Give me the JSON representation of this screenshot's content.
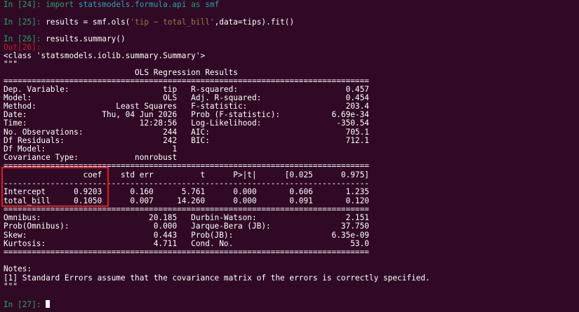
{
  "terminal": {
    "cells": [
      {
        "prompt": "In [24]: ",
        "import_kw": "import",
        "module": "statsmodels.formula.api",
        "as_kw": "as",
        "alias": "smf"
      },
      {
        "prompt": "In [25]: ",
        "code_pre": "results = smf.ols(",
        "code_str": "'tip ~ total_bill'",
        "code_post": ",data=tips).fit()"
      },
      {
        "prompt": "In [26]: ",
        "code": "results.summary()"
      },
      {
        "prompt": "In [27]: "
      }
    ],
    "out_prompt": "Out[26]:",
    "output_lines": [
      "<class 'statsmodels.iolib.summary.Summary'>",
      "\"\"\"",
      "                            OLS Regression Results",
      "==============================================================================",
      "Dep. Variable:                    tip   R-squared:                       0.457",
      "Model:                            OLS   Adj. R-squared:                  0.454",
      "Method:                 Least Squares   F-statistic:                     203.4",
      "Date:                Thu, 04 Jun 2026   Prob (F-statistic):           6.69e-34",
      "Time:                        12:28:56   Log-Likelihood:                -350.54",
      "No. Observations:                 244   AIC:                             705.1",
      "Df Residuals:                     242   BIC:                             712.1",
      "Df Model:                           1",
      "Covariance Type:            nonrobust",
      "==============================================================================",
      "                 coef    std err          t      P>|t|      [0.025      0.975]",
      "------------------------------------------------------------------------------",
      "Intercept      0.9203      0.160      5.761      0.000       0.606       1.235",
      "total_bill     0.1050      0.007     14.260      0.000       0.091       0.120",
      "==============================================================================",
      "Omnibus:                       20.185   Durbin-Watson:                   2.151",
      "Prob(Omnibus):                  0.000   Jarque-Bera (JB):               37.750",
      "Skew:                           0.443   Prob(JB):                     6.35e-09",
      "Kurtosis:                       4.711   Cond. No.                         53.0",
      "==============================================================================",
      "",
      "Notes:",
      "[1] Standard Errors assume that the covariance matrix of the errors is correctly specified.",
      "\"\"\""
    ],
    "colors": {
      "background": "#300a24",
      "text": "#ffffff",
      "in_prompt": "#26a269",
      "out_prompt": "#c01c28",
      "highlight_box": "#e01b24"
    }
  }
}
